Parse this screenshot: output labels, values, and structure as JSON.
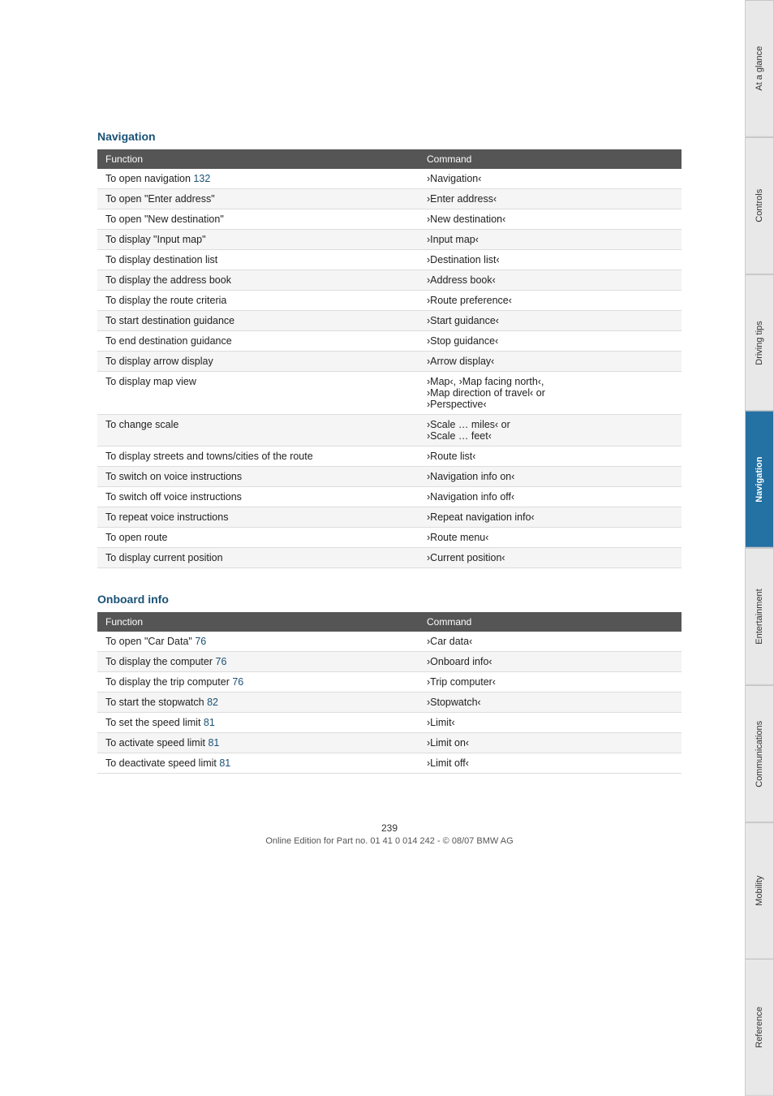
{
  "navigation_section": {
    "heading": "Navigation",
    "table_headers": [
      "Function",
      "Command"
    ],
    "rows": [
      {
        "function": "To open navigation  132",
        "command": "›Navigation‹",
        "has_link": true,
        "link_text": "132"
      },
      {
        "function": "To open \"Enter address\"",
        "command": "›Enter address‹"
      },
      {
        "function": "To open \"New destination\"",
        "command": "›New destination‹"
      },
      {
        "function": "To display \"Input map\"",
        "command": "›Input map‹"
      },
      {
        "function": "To display destination list",
        "command": "›Destination list‹"
      },
      {
        "function": "To display the address book",
        "command": "›Address book‹"
      },
      {
        "function": "To display the route criteria",
        "command": "›Route preference‹"
      },
      {
        "function": "To start destination guidance",
        "command": "›Start guidance‹"
      },
      {
        "function": "To end destination guidance",
        "command": "›Stop guidance‹"
      },
      {
        "function": "To display arrow display",
        "command": "›Arrow display‹"
      },
      {
        "function": "To display map view",
        "command": "›Map‹, ›Map facing north‹,\n›Map direction of travel‹ or\n›Perspective‹"
      },
      {
        "function": "To change scale",
        "command": "›Scale … miles‹ or\n›Scale … feet‹"
      },
      {
        "function": "To display streets and towns/cities of the route",
        "command": "›Route list‹"
      },
      {
        "function": "To switch on voice instructions",
        "command": "›Navigation info on‹"
      },
      {
        "function": "To switch off voice instructions",
        "command": "›Navigation info off‹"
      },
      {
        "function": "To repeat voice instructions",
        "command": "›Repeat navigation info‹"
      },
      {
        "function": "To open route",
        "command": "›Route menu‹"
      },
      {
        "function": "To display current position",
        "command": "›Current position‹"
      }
    ]
  },
  "onboard_section": {
    "heading": "Onboard info",
    "table_headers": [
      "Function",
      "Command"
    ],
    "rows": [
      {
        "function": "To open \"Car Data\"  76",
        "command": "›Car data‹",
        "has_link": true,
        "link_text": "76"
      },
      {
        "function": "To display the computer  76",
        "command": "›Onboard info‹",
        "has_link": true,
        "link_text": "76"
      },
      {
        "function": "To display the trip computer  76",
        "command": "›Trip computer‹",
        "has_link": true,
        "link_text": "76"
      },
      {
        "function": "To start the stopwatch  82",
        "command": "›Stopwatch‹",
        "has_link": true,
        "link_text": "82"
      },
      {
        "function": "To set the speed limit  81",
        "command": "›Limit‹",
        "has_link": true,
        "link_text": "81"
      },
      {
        "function": "To activate speed limit  81",
        "command": "›Limit on‹",
        "has_link": true,
        "link_text": "81"
      },
      {
        "function": "To deactivate speed limit  81",
        "command": "›Limit off‹",
        "has_link": true,
        "link_text": "81"
      }
    ]
  },
  "sidebar": {
    "tabs": [
      {
        "label": "At a glance",
        "active": false
      },
      {
        "label": "Controls",
        "active": false
      },
      {
        "label": "Driving tips",
        "active": false
      },
      {
        "label": "Navigation",
        "active": true
      },
      {
        "label": "Entertainment",
        "active": false
      },
      {
        "label": "Communications",
        "active": false
      },
      {
        "label": "Mobility",
        "active": false
      },
      {
        "label": "Reference",
        "active": false
      }
    ]
  },
  "footer": {
    "page_number": "239",
    "text": "Online Edition for Part no. 01 41 0 014 242 - © 08/07 BMW AG"
  }
}
